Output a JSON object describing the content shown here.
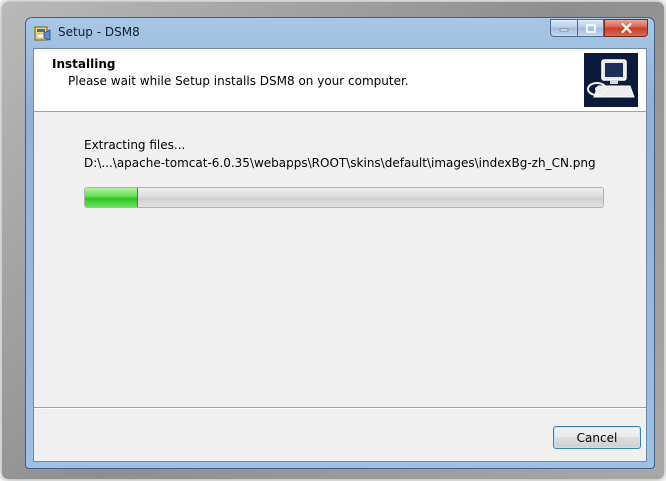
{
  "window": {
    "title": "Setup - DSM8",
    "app_icon": "setup-installer-icon"
  },
  "caption_buttons": {
    "minimize_icon": "minimize-icon",
    "maximize_icon": "maximize-icon",
    "close_icon": "close-icon"
  },
  "header": {
    "title": "Installing",
    "subtitle": "Please wait while Setup installs DSM8 on your computer.",
    "logo_icon": "computer-installer-icon"
  },
  "status": {
    "label": "Extracting files...",
    "current_file": "D:\\...\\apache-tomcat-6.0.35\\webapps\\ROOT\\skins\\default\\images\\indexBg-zh_CN.png"
  },
  "progress": {
    "percent": 10,
    "fill_color": "#34c221"
  },
  "footer": {
    "cancel_label": "Cancel"
  },
  "colors": {
    "title_bar": "#9ec0e2",
    "close_button": "#c6402a",
    "logo_background": "#0b1a3a"
  }
}
